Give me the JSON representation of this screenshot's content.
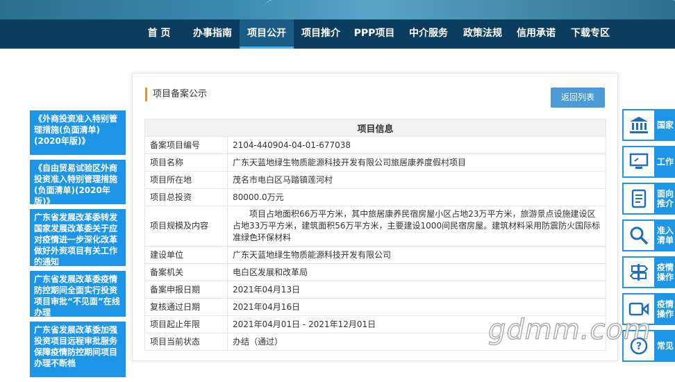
{
  "nav": {
    "items": [
      "首 页",
      "办事指南",
      "项目公开",
      "项目推介",
      "PPP项目",
      "中介服务",
      "政策法规",
      "信用承诺",
      "下载专区"
    ],
    "active_index": 2
  },
  "left_notices": [
    "《外商投资准入特别管理措施(负面清单)(2020年版)》",
    "《自由贸易试验区外商投资准入特别管理措施(负面清单)(2020年版)》",
    "广东省发展改革委转发国家发展改革委关于应对疫情进一步深化改革做好外资项目有关工作的通知",
    "广东省发展改革委疫情防控期间全面实行投资项目审批“不见面”在线办理",
    "广东省发展改革委加强投资项目远程审批服务保障疫情防控期间项目办理不断档"
  ],
  "panel": {
    "title": "项目备案公示",
    "back_label": "返回列表",
    "table_header": "项目信息",
    "rows": [
      {
        "key": "备案项目编号",
        "value": "2104-440904-04-01-677038"
      },
      {
        "key": "项目名称",
        "value": "广东天蓝地绿生物质能源科技开发有限公司旅居康养度假村项目"
      },
      {
        "key": "项目所在地",
        "value": "茂名市电白区马踏镇莲河村"
      },
      {
        "key": "项目总投资",
        "value": "80000.0万元"
      },
      {
        "key": "项目规模及内容",
        "value": "项目占地面积66万平方米，其中旅居康养民宿房屋小区占地23万平方米，旅游景点设施建设区占地33万平方米，建筑面积56万平方米，主要建设1000间民宿房屋。建筑材料采用防震防火国际标准绿色环保材料"
      },
      {
        "key": "建设单位",
        "value": "广东天蓝地绿生物质能源科技开发有限公司"
      },
      {
        "key": "备案机关",
        "value": "电白区发展和改革局"
      },
      {
        "key": "备案申报日期",
        "value": "2021年04月13日"
      },
      {
        "key": "复核通过日期",
        "value": "2021年04月16日"
      },
      {
        "key": "项目起止年限",
        "value": "2021年04月01日 - 2021年12月01日"
      },
      {
        "key": "项目当前状态",
        "value": "办结（通过）"
      }
    ]
  },
  "right_buttons": [
    {
      "icon": "bank-icon",
      "label": "国家"
    },
    {
      "icon": "monitor-icon",
      "label": "工作"
    },
    {
      "icon": "document-icon",
      "label": "面向民\n推介"
    },
    {
      "icon": "search-icon",
      "label": "准入\n清单"
    },
    {
      "icon": "signpost-icon",
      "label": "疫情期\n操作"
    },
    {
      "icon": "video-icon",
      "label": "疫情期\n操作指"
    },
    {
      "icon": "question-icon",
      "label": "常见"
    }
  ],
  "watermark": "gdmm.com"
}
